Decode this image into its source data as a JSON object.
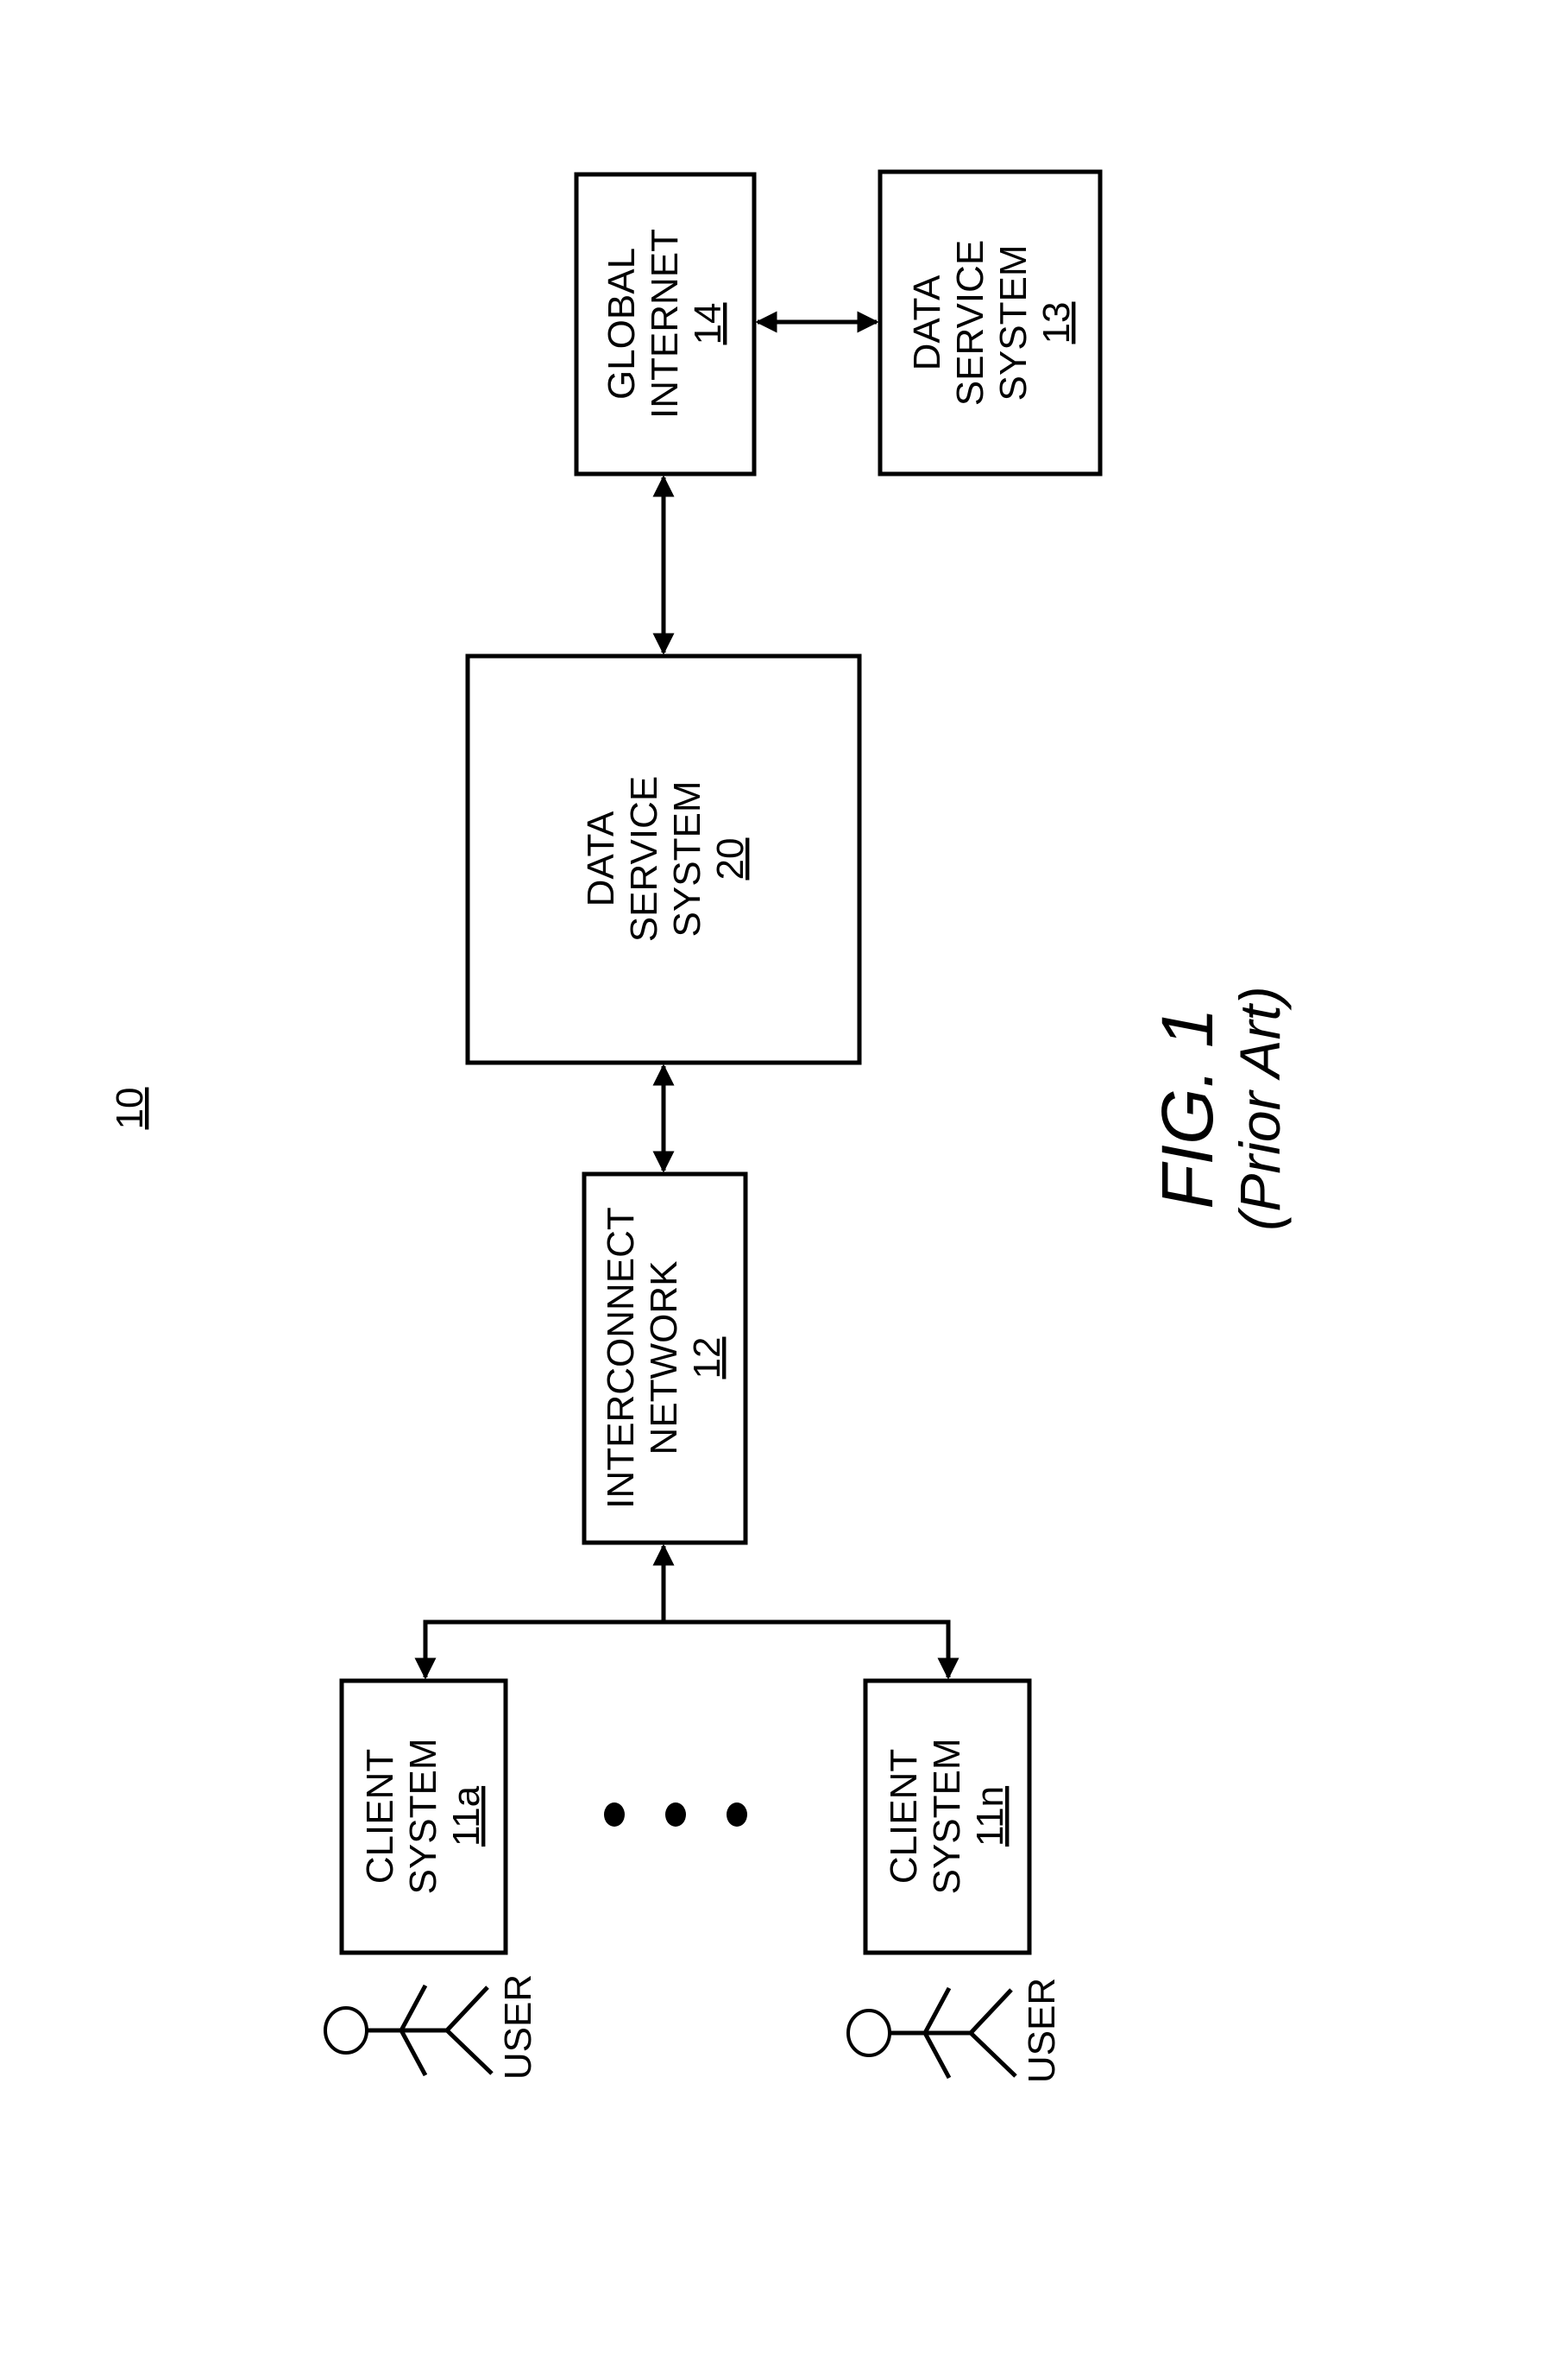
{
  "figure": {
    "reference_number": "10",
    "title": "FIG. 1",
    "subtitle": "(Prior Art)"
  },
  "blocks": {
    "global_internet": {
      "line1": "GLOBAL",
      "line2": "INTERNET",
      "ref": "14"
    },
    "data_service_13": {
      "line1": "DATA",
      "line2": "SERVICE",
      "line3": "SYSTEM",
      "ref": "13"
    },
    "data_service_20": {
      "line1": "DATA",
      "line2": "SERVICE",
      "line3": "SYSTEM",
      "ref": "20"
    },
    "interconnect": {
      "line1": "INTERCONNECT",
      "line2": "NETWORK",
      "ref": "12"
    },
    "client_a": {
      "line1": "CLIENT",
      "line2": "SYSTEM",
      "ref": "11a"
    },
    "client_n": {
      "line1": "CLIENT",
      "line2": "SYSTEM",
      "ref": "11n"
    }
  },
  "users": [
    {
      "label": "USER"
    },
    {
      "label": "USER"
    }
  ],
  "ellipsis": "• • •"
}
